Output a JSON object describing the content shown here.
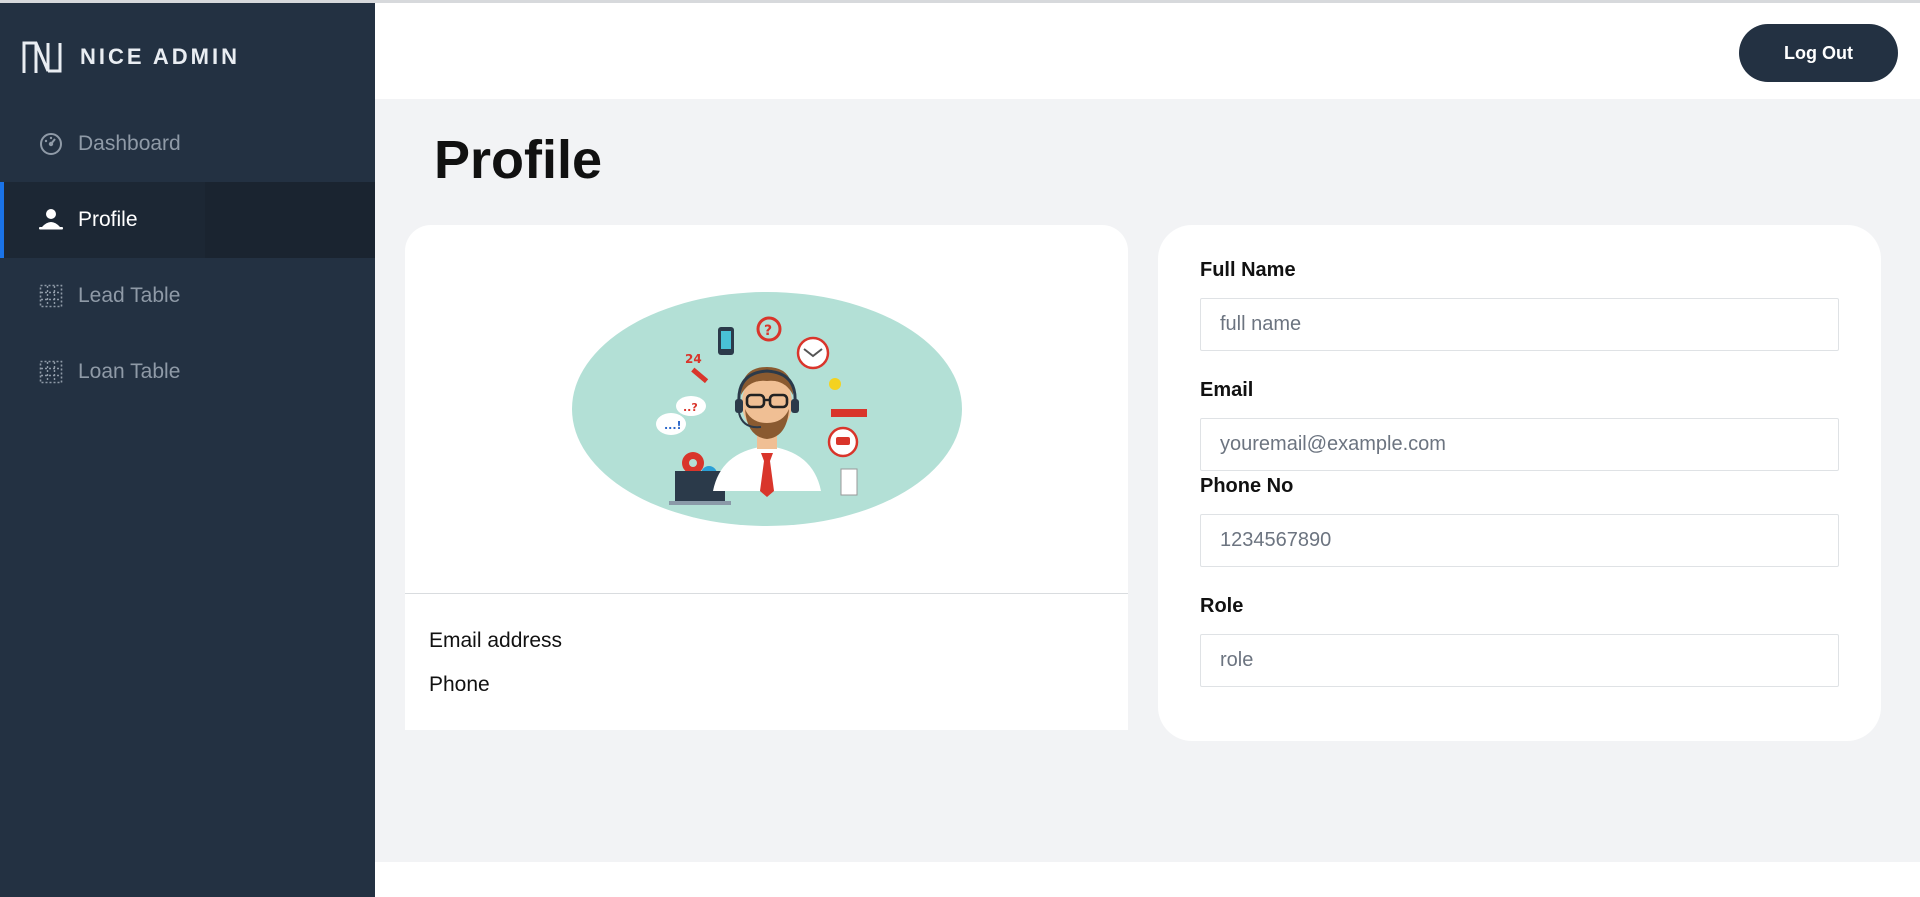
{
  "brand": {
    "name": "NICE ADMIN",
    "logo_icon": "n-logo-icon"
  },
  "sidebar": {
    "items": [
      {
        "label": "Dashboard",
        "icon": "dashboard-icon",
        "active": false
      },
      {
        "label": "Profile",
        "icon": "user-icon",
        "active": true
      },
      {
        "label": "Lead Table",
        "icon": "grid-icon",
        "active": false
      },
      {
        "label": "Loan Table",
        "icon": "grid-icon",
        "active": false
      }
    ]
  },
  "header": {
    "logout_label": "Log Out"
  },
  "page": {
    "title": "Profile"
  },
  "profile_card": {
    "illustration": "customer-support-illustration",
    "email_label": "Email address",
    "phone_label": "Phone"
  },
  "form": {
    "full_name": {
      "label": "Full Name",
      "placeholder": "full name"
    },
    "email": {
      "label": "Email",
      "placeholder": "youremail@example.com"
    },
    "phone": {
      "label": "Phone No",
      "placeholder": "1234567890"
    },
    "role": {
      "label": "Role",
      "placeholder": "role"
    }
  },
  "colors": {
    "sidebar_bg": "#233142",
    "accent": "#1a73e8",
    "page_bg": "#f2f3f5",
    "illustration_bg": "#b3e0d6"
  }
}
